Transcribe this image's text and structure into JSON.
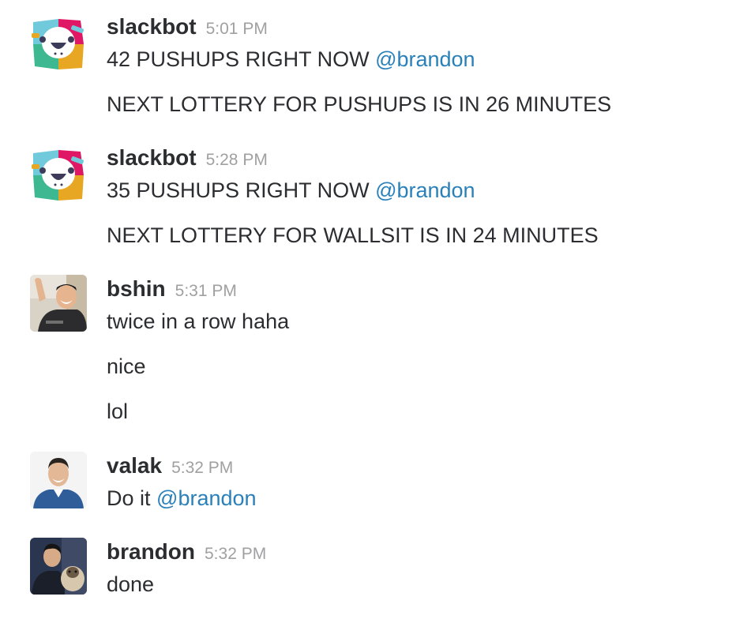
{
  "messages": [
    {
      "sender": "slackbot",
      "time": "5:01 PM",
      "avatar": "slackbot-avatar",
      "lines": [
        {
          "text": "42 PUSHUPS RIGHT NOW ",
          "mention": "@brandon"
        },
        {
          "text": "NEXT LOTTERY FOR PUSHUPS IS IN 26 MINUTES"
        }
      ]
    },
    {
      "sender": "slackbot",
      "time": "5:28 PM",
      "avatar": "slackbot-avatar",
      "lines": [
        {
          "text": "35 PUSHUPS RIGHT NOW ",
          "mention": "@brandon"
        },
        {
          "text": "NEXT LOTTERY FOR WALLSIT IS IN 24 MINUTES"
        }
      ]
    },
    {
      "sender": "bshin",
      "time": "5:31 PM",
      "avatar": "user-photo-avatar",
      "lines": [
        {
          "text": "twice in a row haha"
        },
        {
          "text": "nice"
        },
        {
          "text": "lol"
        }
      ]
    },
    {
      "sender": "valak",
      "time": "5:32 PM",
      "avatar": "user-photo-avatar",
      "lines": [
        {
          "text": "Do it ",
          "mention": "@brandon"
        }
      ]
    },
    {
      "sender": "brandon",
      "time": "5:32 PM",
      "avatar": "user-photo-avatar",
      "lines": [
        {
          "text": "done"
        }
      ]
    }
  ],
  "colors": {
    "text": "#2c2d30",
    "timestamp": "#a0a0a2",
    "mention": "#2a80b9",
    "background": "#ffffff"
  }
}
